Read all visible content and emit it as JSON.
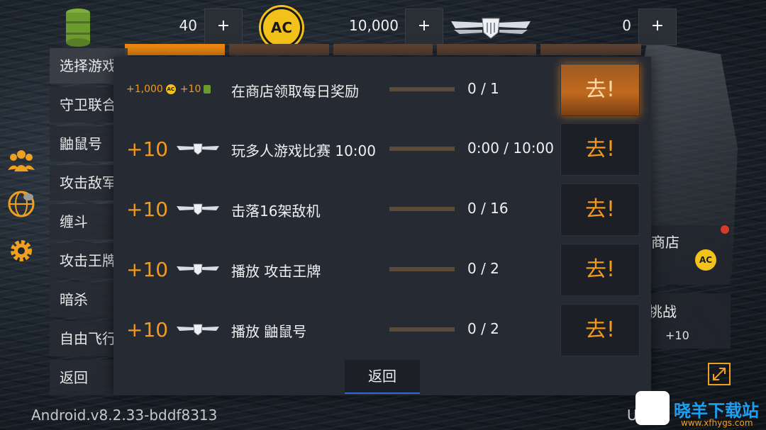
{
  "currencies": [
    {
      "name": "fuel",
      "icon": "oil-barrel-icon",
      "value": "40"
    },
    {
      "name": "ac",
      "icon": "ac-coin-icon",
      "value": "10,000",
      "coin_label": "AC"
    },
    {
      "name": "wings",
      "icon": "wings-badge-icon",
      "value": "0"
    }
  ],
  "plus_label": "+",
  "left_menu": [
    {
      "label": "选择游戏"
    },
    {
      "label": "守卫联合"
    },
    {
      "label": "鼬鼠号"
    },
    {
      "label": "攻击敌军"
    },
    {
      "label": "缠斗"
    },
    {
      "label": "攻击王牌"
    },
    {
      "label": "暗杀"
    },
    {
      "label": "自由飞行"
    },
    {
      "label": "返回"
    }
  ],
  "side_icons": [
    "friends-icon",
    "globe-chat-icon",
    "settings-gear-icon"
  ],
  "version": "Android.v8.2.33-bddf8313",
  "version_right": "U",
  "right_panels": {
    "shop_title": "商店",
    "shop_coin_label": "AC",
    "challenge_title": "挑战",
    "challenge_reward": "+10"
  },
  "tasks": [
    {
      "reward_coins": "+1,000",
      "reward_fuel": "+10",
      "text": "在商店领取每日奖励",
      "progress": "0 / 1",
      "fraction": 0,
      "button": "去!",
      "highlight": true
    },
    {
      "reward_wings": "+10",
      "text": "玩多人游戏比赛 10:00",
      "progress": "0:00 / 10:00",
      "fraction": 0,
      "button": "去!",
      "highlight": false
    },
    {
      "reward_wings": "+10",
      "text": "击落16架敌机",
      "progress": "0 / 16",
      "fraction": 0,
      "button": "去!",
      "highlight": false
    },
    {
      "reward_wings": "+10",
      "text": "播放 攻击王牌",
      "progress": "0 / 2",
      "fraction": 0,
      "button": "去!",
      "highlight": false
    },
    {
      "reward_wings": "+10",
      "text": "播放 鼬鼠号",
      "progress": "0 / 2",
      "fraction": 0,
      "button": "去!",
      "highlight": false
    }
  ],
  "back_button": "返回",
  "watermark": {
    "name": "晓羊下载站",
    "url": "www.xfhygs.com"
  },
  "colors": {
    "accent": "#f29a1d",
    "tab_active": "#f08a10",
    "coin": "#f3c21a"
  }
}
